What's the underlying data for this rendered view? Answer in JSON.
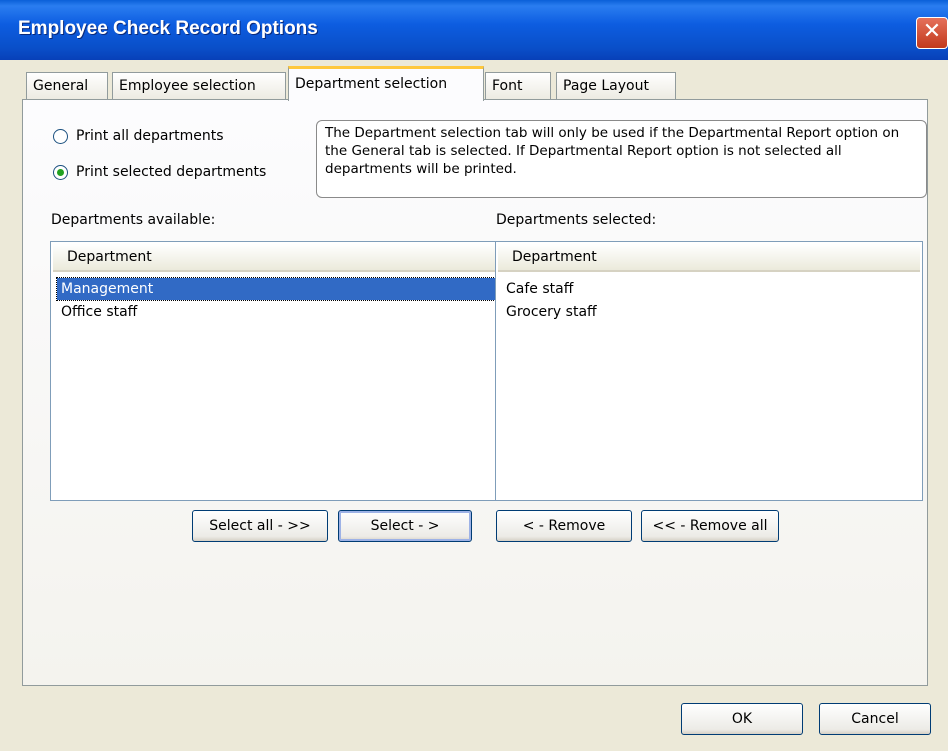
{
  "window": {
    "title": "Employee Check Record Options",
    "close_glyph": "✕"
  },
  "tabs": [
    {
      "label": "General"
    },
    {
      "label": "Employee selection"
    },
    {
      "label": "Department selection",
      "active": true
    },
    {
      "label": "Font"
    },
    {
      "label": "Page Layout"
    }
  ],
  "print_options": {
    "all_label": "Print all departments",
    "selected_label": "Print selected departments",
    "selected_value": "selected"
  },
  "info_text": "The Department selection tab will only be used if the Departmental Report option on the General tab is selected.  If Departmental Report option is not selected all departments will be printed.",
  "available": {
    "label": "Departments available:",
    "column_header": "Department",
    "items": [
      "Management",
      "Office staff"
    ],
    "selected_item": "Management"
  },
  "selected": {
    "label": "Departments selected:",
    "column_header": "Department",
    "items": [
      "Cafe staff",
      "Grocery staff"
    ]
  },
  "buttons": {
    "select_all": "Select all - >>",
    "select": "Select - >",
    "remove": "< - Remove",
    "remove_all": "<< - Remove all",
    "ok": "OK",
    "cancel": "Cancel"
  }
}
